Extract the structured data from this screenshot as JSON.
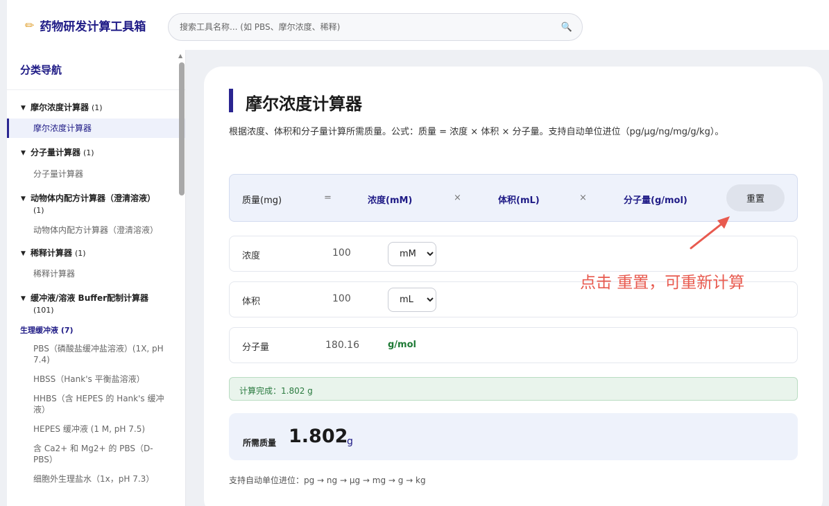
{
  "header": {
    "logo_icon": "pencil-icon",
    "title": "药物研发计算工具箱",
    "search_placeholder": "搜索工具名称... (如 PBS、摩尔浓度、稀释)"
  },
  "sidebar": {
    "title": "分类导航",
    "categories": [
      {
        "label": "摩尔浓度计算器",
        "count": "(1)",
        "items": [
          "摩尔浓度计算器"
        ]
      },
      {
        "label": "分子量计算器",
        "count": "(1)",
        "items": [
          "分子量计算器"
        ]
      },
      {
        "label": "动物体内配方计算器（澄清溶液）",
        "count": "(1)",
        "items": [
          "动物体内配方计算器（澄清溶液）"
        ]
      },
      {
        "label": "稀释计算器",
        "count": "(1)",
        "items": [
          "稀释计算器"
        ]
      },
      {
        "label": "缓冲液/溶液 Buffer配制计算器",
        "count": "(101)",
        "subcategory": "生理缓冲液 (7)",
        "items": [
          "PBS（磷酸盐缓冲盐溶液）(1X, pH 7.4)",
          "HBSS（Hank's 平衡盐溶液）",
          "HHBS（含 HEPES 的 Hank's 缓冲液）",
          "HEPES 缓冲液 (1 M, pH 7.5)",
          "含 Ca2+ 和 Mg2+ 的 PBS（D-PBS）",
          "细胞外生理盐水（1x，pH 7.3）"
        ]
      }
    ]
  },
  "main": {
    "title": "摩尔浓度计算器",
    "description": "根据浓度、体积和分子量计算所需质量。公式：质量 = 浓度 × 体积 × 分子量。支持自动单位进位（pg/μg/ng/mg/g/kg）。",
    "formula": {
      "mass": "质量(mg)",
      "equals": "=",
      "concentration": "浓度(mM)",
      "times": "×",
      "volume": "体积(mL)",
      "mw": "分子量(g/mol)"
    },
    "reset_label": "重置",
    "inputs": {
      "concentration": {
        "label": "浓度",
        "value": "100",
        "unit": "mM",
        "unit_options": [
          "mM"
        ]
      },
      "volume": {
        "label": "体积",
        "value": "100",
        "unit": "mL",
        "unit_options": [
          "mL"
        ]
      },
      "mw": {
        "label": "分子量",
        "value": "180.16",
        "unit": "g/mol"
      }
    },
    "status": "计算完成：1.802 g",
    "result": {
      "label": "所需质量",
      "value": "1.802",
      "unit": "g"
    },
    "footer_note": "支持自动单位进位：pg → ng → μg → mg → g → kg"
  },
  "annotation": {
    "text": "点击 重置，可重新计算",
    "color": "#e85a4f"
  },
  "colors": {
    "brand": "#1f1b86",
    "accent_bar": "#2a2590",
    "success": "#2a7a3f",
    "mw_unit": "#1e7a35"
  }
}
